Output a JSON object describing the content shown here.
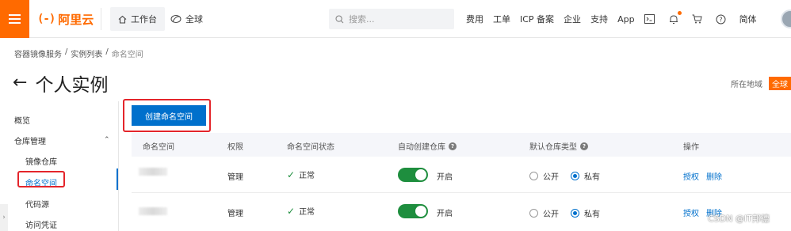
{
  "topbar": {
    "logo_text": "阿里云",
    "workbench": "工作台",
    "global": "全球",
    "search_placeholder": "搜索...",
    "links": [
      "费用",
      "工单",
      "ICP 备案",
      "企业",
      "支持",
      "App"
    ],
    "language": "简体",
    "brand_color": "#ff6a00"
  },
  "breadcrumb": [
    "容器镜像服务",
    "实例列表",
    "命名空间"
  ],
  "page": {
    "title": "个人实例",
    "region_label": "所在地域",
    "region_value": "全球"
  },
  "sidebar": {
    "items": [
      "概览",
      "仓库管理",
      "镜像仓库",
      "命名空间",
      "代码源",
      "访问凭证"
    ],
    "active": "命名空间"
  },
  "create_button": "创建命名空间",
  "table": {
    "headers": [
      "命名空间",
      "权限",
      "命名空间状态",
      "自动创建仓库",
      "默认仓库类型",
      "操作"
    ],
    "rows": [
      {
        "permission": "管理",
        "status": "正常",
        "auto_create": "开启",
        "public_label": "公开",
        "private_label": "私有",
        "type_selected": "私有",
        "actions": [
          "授权",
          "删除"
        ]
      },
      {
        "permission": "管理",
        "status": "正常",
        "auto_create": "开启",
        "public_label": "公开",
        "private_label": "私有",
        "type_selected": "私有",
        "actions": [
          "授权",
          "删除"
        ]
      }
    ]
  },
  "watermark": "CSDN @IT邦德",
  "colors": {
    "accent_blue": "#0070cc",
    "success_green": "#1e8e3e",
    "highlight_red": "#e4252b"
  }
}
